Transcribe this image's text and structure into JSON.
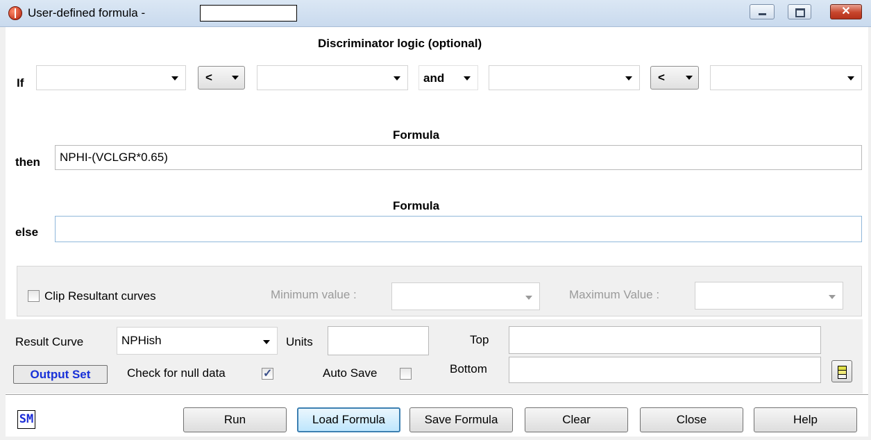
{
  "window": {
    "title": "User-defined formula  -",
    "title_field_value": "",
    "close_glyph": "✕"
  },
  "discriminator": {
    "heading": "Discriminator logic (optional)",
    "if_label": "If",
    "field1": "",
    "op1": "<",
    "field2": "",
    "conjunction": "and",
    "field3": "",
    "op2": "<",
    "field4": ""
  },
  "then_section": {
    "heading": "Formula",
    "label": "then",
    "formula": "NPHI-(VCLGR*0.65)"
  },
  "else_section": {
    "heading": "Formula",
    "label": "else",
    "formula": ""
  },
  "clip": {
    "checkbox_label": "Clip Resultant curves",
    "checked": false,
    "min_label": "Minimum value :",
    "min_value": "",
    "max_label": "Maximum Value :",
    "max_value": ""
  },
  "result": {
    "result_curve_label": "Result Curve",
    "result_curve_value": "NPHish",
    "units_label": "Units",
    "units_value": "",
    "top_label": "Top",
    "top_value": "",
    "bottom_label": "Bottom",
    "bottom_value": "",
    "output_set_label": "Output Set",
    "check_null_label": "Check for null data",
    "check_null_checked": true,
    "auto_save_label": "Auto Save",
    "auto_save_checked": false
  },
  "footer": {
    "sm_icon_text": "SM",
    "run": "Run",
    "load_formula": "Load Formula",
    "save_formula": "Save Formula",
    "clear": "Clear",
    "close": "Close",
    "help": "Help"
  },
  "colors": {
    "accent_blue": "#1730d8",
    "focus_border": "#3c7fb1"
  }
}
